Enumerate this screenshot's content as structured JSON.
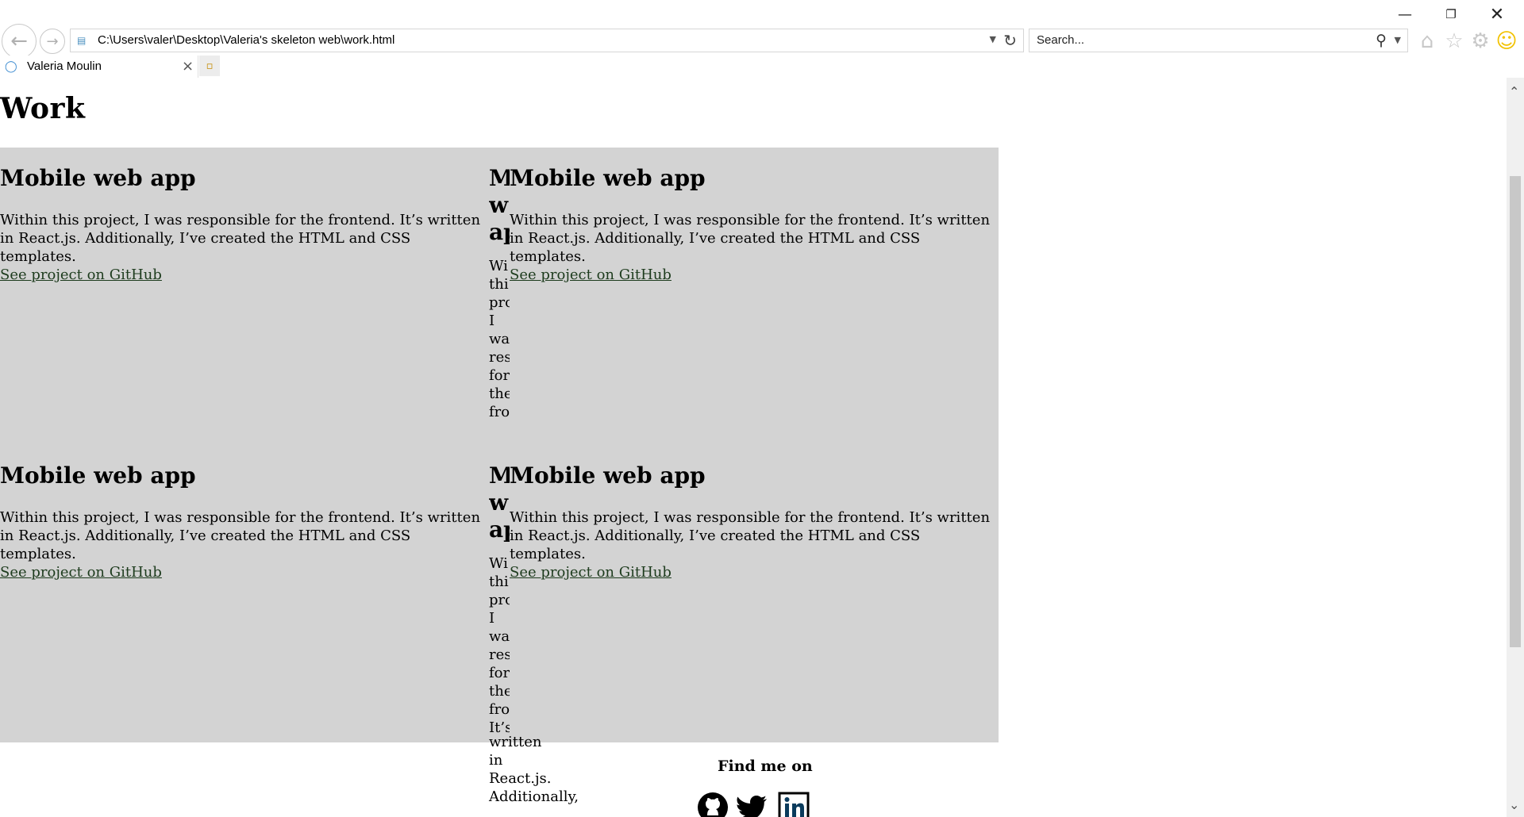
{
  "browser": {
    "address": "C:\\Users\\valer\\Desktop\\Valeria's skeleton web\\work.html",
    "search_placeholder": "Search...",
    "tab_title": "Valeria Moulin"
  },
  "page": {
    "heading": "Work",
    "cards": [
      {
        "title": "Mobile web app",
        "description": "Within this project, I was responsible for the frontend. It’s written in React.js. Additionally, I’ve created the HTML and CSS templates.",
        "link": "See project on GitHub"
      },
      {
        "title": "Mobile web app",
        "description": "Within this project, I was responsible for the frontend. It’s written in React.js. Additionally, I’ve created the HTML and CSS templates.",
        "link": "See project on GitHub"
      },
      {
        "title": "Mobile web app",
        "description": "Within this project, I was responsible for the frontend. It’s written in React.js. Additionally, I’ve created the HTML and CSS templates.",
        "link": "See project on GitHub"
      },
      {
        "title": "Mobile web app",
        "description": "Within this project, I was responsible for the frontend. It’s written in React.js. Additionally, I’ve created the HTML and CSS templates.",
        "link": "See project on GitHub"
      }
    ],
    "overflow_fragment": {
      "title_top": "M",
      "title_mid": "w",
      "title_bot": "ap",
      "words": [
        "Wi",
        "thi",
        "pro",
        "I",
        "wa",
        "res",
        "for",
        "the",
        "fro",
        "It’s"
      ],
      "tail": [
        "written",
        "in",
        "React.js.",
        "Additionally,"
      ]
    },
    "footer_label": "Find me on"
  },
  "icons": {
    "back": "back-arrow-icon",
    "forward": "forward-arrow-icon",
    "refresh": "refresh-icon",
    "search": "search-icon",
    "home": "home-icon",
    "favorites": "star-icon",
    "settings": "gear-icon",
    "feedback": "smiley-icon",
    "social": [
      "github-icon",
      "twitter-icon",
      "linkedin-icon"
    ]
  },
  "colors": {
    "section_bg": "#d3d3d3",
    "link": "#1d3b1d",
    "smiley": "#f2c200"
  }
}
